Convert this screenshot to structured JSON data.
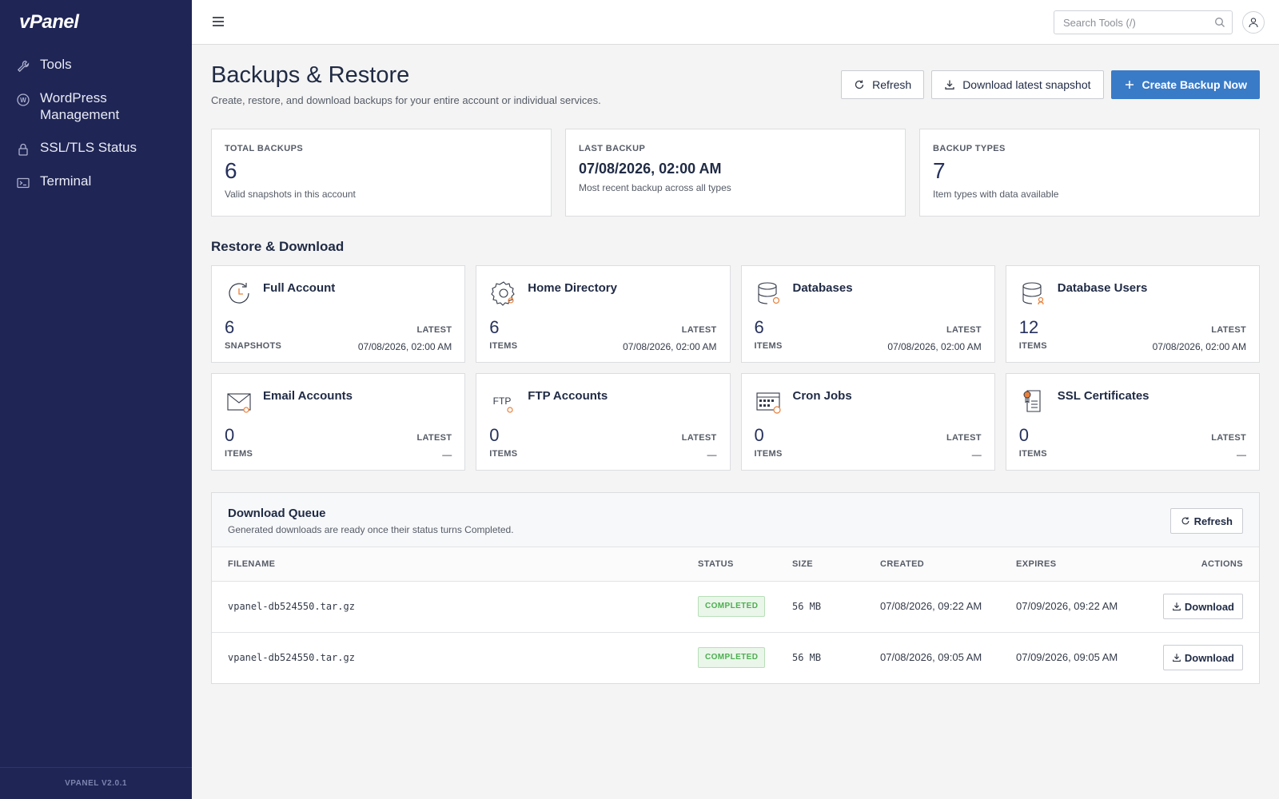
{
  "app": {
    "logo": "vPanel",
    "version": "VPANEL V2.0.1"
  },
  "sidebar": {
    "items": [
      {
        "label": "Tools",
        "icon": "wrench-icon"
      },
      {
        "label": "WordPress Management",
        "icon": "wordpress-icon"
      },
      {
        "label": "SSL/TLS Status",
        "icon": "lock-icon"
      },
      {
        "label": "Terminal",
        "icon": "terminal-icon"
      }
    ]
  },
  "topbar": {
    "search_placeholder": "Search Tools (/)"
  },
  "page": {
    "title": "Backups & Restore",
    "subtitle": "Create, restore, and download backups for your entire account or individual services.",
    "actions": {
      "refresh": "Refresh",
      "download_latest": "Download latest snapshot",
      "create": "Create Backup Now"
    }
  },
  "stats": [
    {
      "label": "TOTAL BACKUPS",
      "value": "6",
      "desc": "Valid snapshots in this account"
    },
    {
      "label": "LAST BACKUP",
      "value": "07/08/2026, 02:00 AM",
      "desc": "Most recent backup across all types"
    },
    {
      "label": "BACKUP TYPES",
      "value": "7",
      "desc": "Item types with data available"
    }
  ],
  "restore": {
    "title": "Restore & Download",
    "latest_label": "LATEST",
    "items": [
      {
        "name": "Full Account",
        "count": "6",
        "unit": "SNAPSHOTS",
        "latest": "07/08/2026, 02:00 AM",
        "icon": "full-account-icon"
      },
      {
        "name": "Home Directory",
        "count": "6",
        "unit": "ITEMS",
        "latest": "07/08/2026, 02:00 AM",
        "icon": "home-directory-icon"
      },
      {
        "name": "Databases",
        "count": "6",
        "unit": "ITEMS",
        "latest": "07/08/2026, 02:00 AM",
        "icon": "database-icon"
      },
      {
        "name": "Database Users",
        "count": "12",
        "unit": "ITEMS",
        "latest": "07/08/2026, 02:00 AM",
        "icon": "database-users-icon"
      },
      {
        "name": "Email Accounts",
        "count": "0",
        "unit": "ITEMS",
        "latest": "—",
        "icon": "email-icon"
      },
      {
        "name": "FTP Accounts",
        "count": "0",
        "unit": "ITEMS",
        "latest": "—",
        "icon": "ftp-icon",
        "icon_text": "FTP"
      },
      {
        "name": "Cron Jobs",
        "count": "0",
        "unit": "ITEMS",
        "latest": "—",
        "icon": "cron-icon"
      },
      {
        "name": "SSL Certificates",
        "count": "0",
        "unit": "ITEMS",
        "latest": "—",
        "icon": "certificate-icon"
      }
    ]
  },
  "queue": {
    "title": "Download Queue",
    "subtitle": "Generated downloads are ready once their status turns Completed.",
    "refresh": "Refresh",
    "columns": [
      "FILENAME",
      "STATUS",
      "SIZE",
      "CREATED",
      "EXPIRES",
      "ACTIONS"
    ],
    "rows": [
      {
        "filename": "vpanel-db524550.tar.gz",
        "status": "COMPLETED",
        "size": "56 MB",
        "created": "07/08/2026, 09:22 AM",
        "expires": "07/09/2026, 09:22 AM",
        "action": "Download"
      },
      {
        "filename": "vpanel-db524550.tar.gz",
        "status": "COMPLETED",
        "size": "56 MB",
        "created": "07/08/2026, 09:05 AM",
        "expires": "07/09/2026, 09:05 AM",
        "action": "Download"
      }
    ]
  },
  "colors": {
    "sidebar": "#1f2555",
    "primary": "#3a7bc8",
    "accent_icon": "#e8803a",
    "success": "#4caf50"
  }
}
